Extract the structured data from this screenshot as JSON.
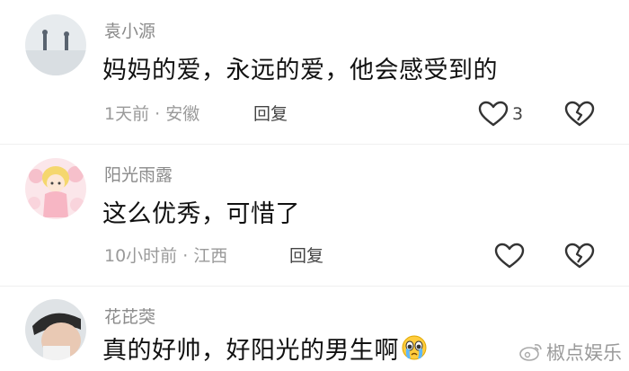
{
  "comments": [
    {
      "username": "袁小源",
      "text": "妈妈的爱，永远的爱，他会感受到的",
      "meta": "1天前 · 安徽",
      "reply_label": "回复",
      "like_count": "3"
    },
    {
      "username": "阳光雨露",
      "text": "这么优秀，可惜了",
      "meta": "10小时前 · 江西",
      "reply_label": "回复",
      "like_count": ""
    },
    {
      "username": "花芘葖",
      "text": "真的好帅，好阳光的男生啊",
      "emoji": "crying-face-emoji",
      "meta": "",
      "reply_label": ""
    }
  ],
  "watermark": {
    "text": "椒点娱乐",
    "icon": "weibo-logo-icon"
  },
  "colors": {
    "meta": "#9a9a9a",
    "text": "#111111",
    "icon": "#333333"
  }
}
